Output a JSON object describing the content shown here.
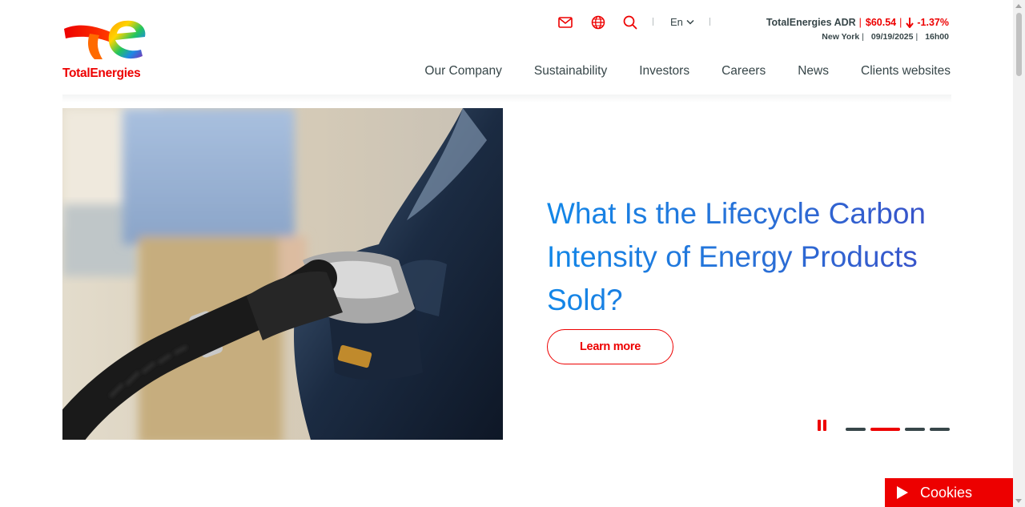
{
  "brand": {
    "name": "TotalEnergies",
    "color": "#ed0000"
  },
  "utility": {
    "icons": [
      "mail-icon",
      "globe-icon",
      "search-icon"
    ],
    "language": "En"
  },
  "stock": {
    "label": "TotalEnergies ADR",
    "price": "$60.54",
    "change": "-1.37%",
    "direction": "down",
    "market": "New York",
    "date": "09/19/2025",
    "time": "16h00"
  },
  "nav": {
    "items": [
      "Our Company",
      "Sustainability",
      "Investors",
      "Careers",
      "News",
      "Clients websites"
    ]
  },
  "hero": {
    "title": "What Is the Lifecycle Carbon Intensity of Energy Products Sold?",
    "button": "Learn more",
    "slides_total": 4,
    "slide_active": 2
  },
  "cookies": {
    "label": "Cookies"
  }
}
